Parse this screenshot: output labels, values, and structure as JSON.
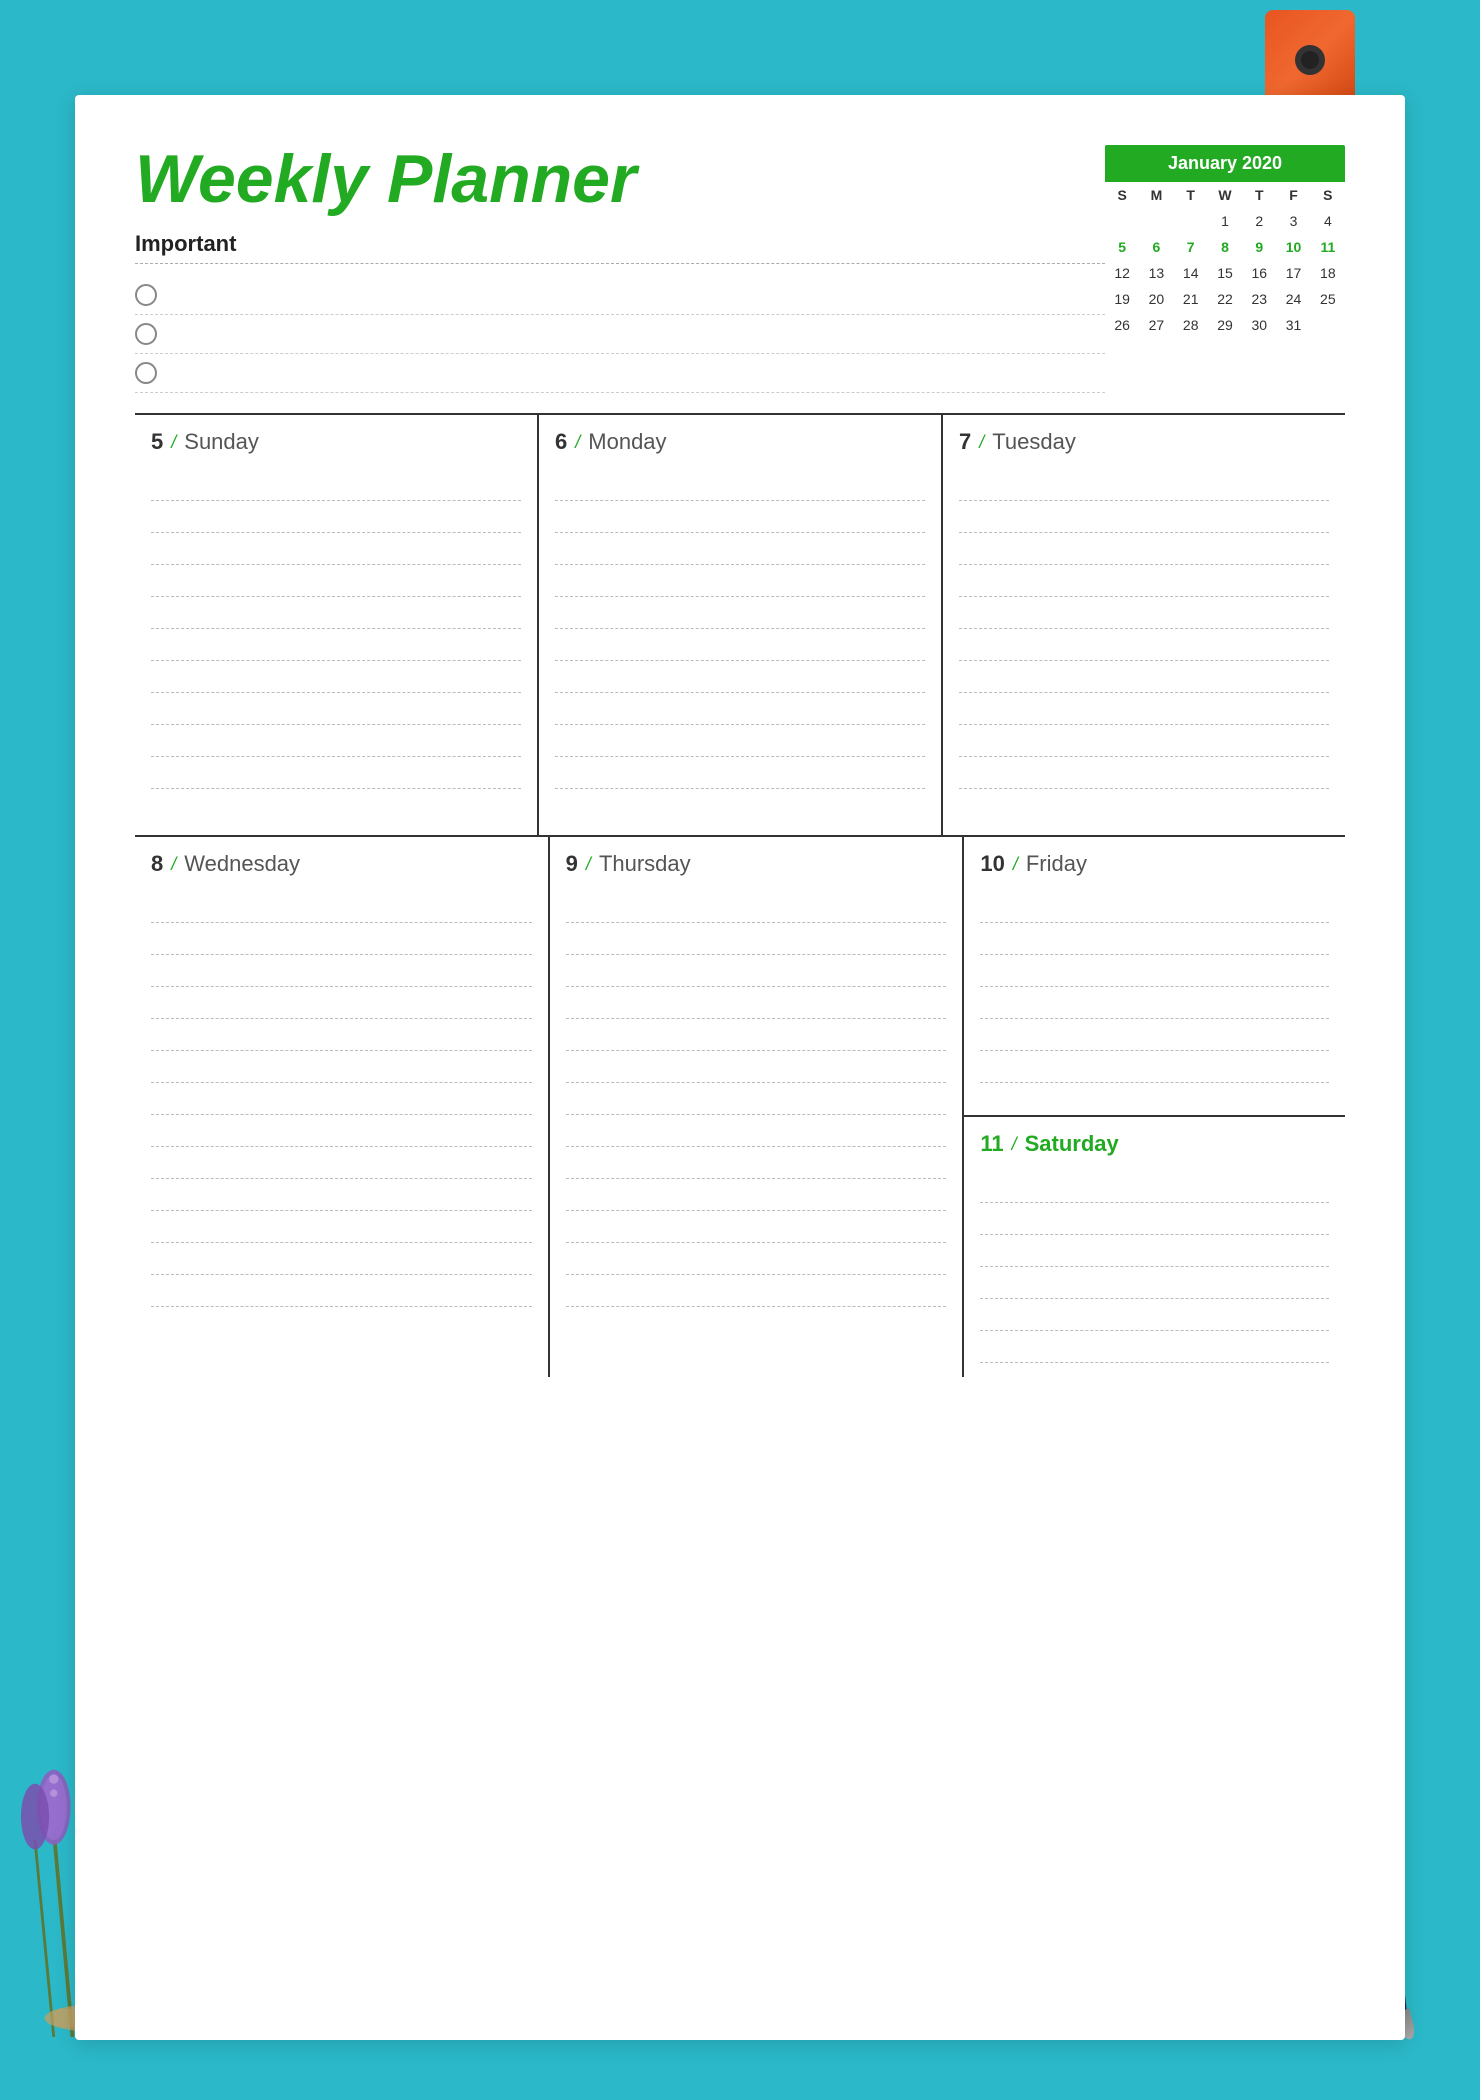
{
  "page": {
    "title": "Weekly Planner",
    "important_label": "Important",
    "background_color": "#2bb8c8",
    "accent_color": "#22aa22"
  },
  "calendar": {
    "month_year": "January 2020",
    "headers": [
      "S",
      "M",
      "T",
      "W",
      "T",
      "F",
      "S"
    ],
    "weeks": [
      [
        "",
        "",
        "",
        "1",
        "2",
        "3",
        "4"
      ],
      [
        "5",
        "6",
        "7",
        "8",
        "9",
        "10",
        "11"
      ],
      [
        "12",
        "13",
        "14",
        "15",
        "16",
        "17",
        "18"
      ],
      [
        "19",
        "20",
        "21",
        "22",
        "23",
        "24",
        "25"
      ],
      [
        "26",
        "27",
        "28",
        "29",
        "30",
        "31",
        ""
      ]
    ]
  },
  "important": {
    "checkboxes": [
      {
        "id": 1,
        "text": ""
      },
      {
        "id": 2,
        "text": ""
      },
      {
        "id": 3,
        "text": ""
      }
    ]
  },
  "days_row1": [
    {
      "num": "5",
      "name": "Sunday"
    },
    {
      "num": "6",
      "name": "Monday"
    },
    {
      "num": "7",
      "name": "Tuesday"
    }
  ],
  "days_row2_left": [
    {
      "num": "8",
      "name": "Wednesday"
    },
    {
      "num": "9",
      "name": "Thursday"
    }
  ],
  "days_row2_right": {
    "friday": {
      "num": "10",
      "name": "Friday"
    },
    "saturday": {
      "num": "11",
      "name": "Saturday",
      "green": true
    }
  },
  "slash": "/"
}
